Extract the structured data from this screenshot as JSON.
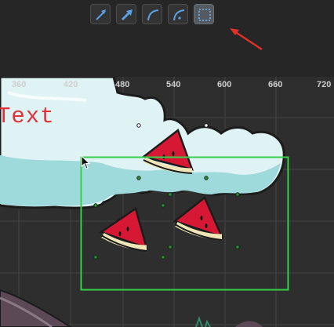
{
  "toolbar": {
    "buttons": [
      {
        "name": "straight-arrow-tool",
        "icon": "arrow-up-right-icon",
        "active": false
      },
      {
        "name": "thick-arrow-tool",
        "icon": "arrow-up-right-bold-icon",
        "active": false
      },
      {
        "name": "arc-tool",
        "icon": "arc-icon",
        "active": false
      },
      {
        "name": "arc-point-tool",
        "icon": "arc-with-point-icon",
        "active": false
      },
      {
        "name": "selection-tool",
        "icon": "dotted-rectangle-icon",
        "active": true
      }
    ],
    "annotation_color": "#e0312b"
  },
  "canvas": {
    "ruler": {
      "ticks": [
        "360",
        "420",
        "480",
        "540",
        "600",
        "660",
        "720"
      ]
    },
    "text_object": "Text",
    "text_color": "#e0303a",
    "selection_color": "#35d04a",
    "grid_color": "#444444",
    "background": "#2e2e2e"
  }
}
